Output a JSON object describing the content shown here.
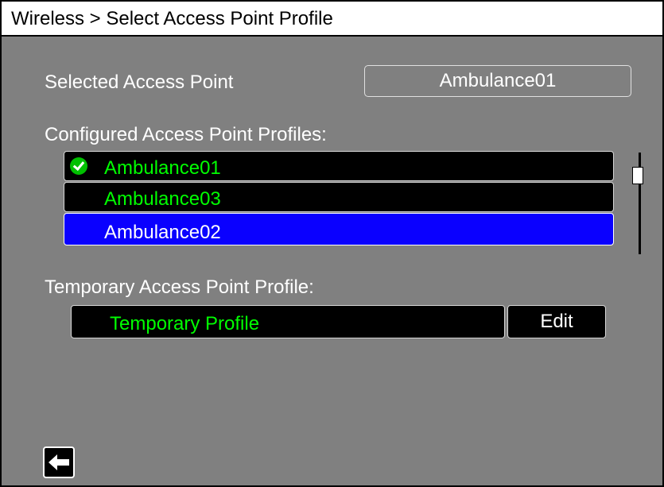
{
  "header": {
    "title": "Wireless > Select Access Point Profile"
  },
  "selected_access_point": {
    "label": "Selected Access Point",
    "value": "Ambulance01"
  },
  "configured_profiles": {
    "label": "Configured Access Point Profiles:",
    "items": [
      {
        "name": "Ambulance01",
        "status": "connected-check-icon"
      },
      {
        "name": "Ambulance03"
      },
      {
        "name": "Ambulance02",
        "highlighted": true
      }
    ]
  },
  "temporary_profile": {
    "label": "Temporary Access Point Profile:",
    "value": "Temporary Profile",
    "edit_label": "Edit"
  },
  "footer": {
    "back_icon": "back-arrow-icon"
  },
  "colors": {
    "background": "#808080",
    "list_text": "#00ff00",
    "highlight": "#0a00ff",
    "titlebar": "#ffffff"
  }
}
